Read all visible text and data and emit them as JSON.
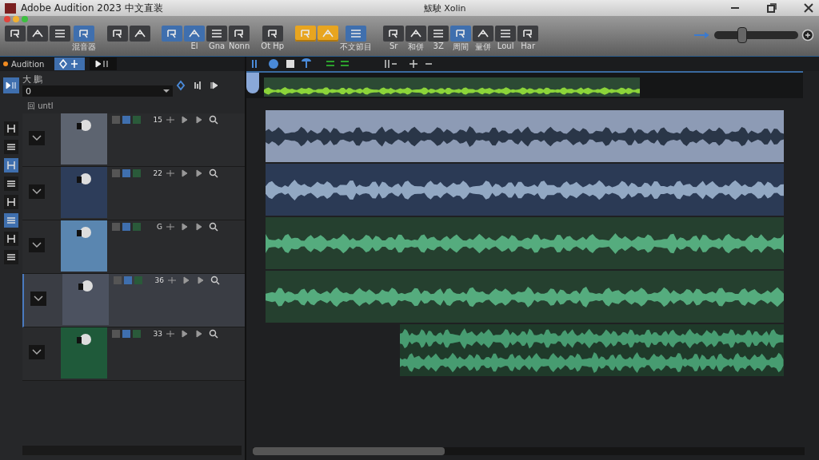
{
  "window": {
    "app_title": "Adobe Audition 2023 中文直装",
    "document_title": "鮁駛 Xolin"
  },
  "toolbar": {
    "groups": [
      {
        "buttons": [
          {
            "kind": "plain",
            "selected": false
          },
          {
            "kind": "plain",
            "selected": false
          },
          {
            "kind": "plain",
            "selected": false
          },
          {
            "kind": "plain",
            "label": "混音器",
            "selected": true
          }
        ]
      },
      {
        "buttons": [
          {
            "kind": "plain",
            "selected": false
          },
          {
            "kind": "plain",
            "selected": false
          }
        ]
      },
      {
        "buttons": [
          {
            "kind": "plain",
            "selected": true
          },
          {
            "kind": "plain",
            "label": "El",
            "selected": true
          },
          {
            "kind": "plain",
            "label": "Gna",
            "selected": false
          },
          {
            "kind": "plain",
            "label": "Nonn",
            "selected": false
          }
        ]
      },
      {
        "buttons": [
          {
            "kind": "plain",
            "label": "Ot Hp",
            "selected": false
          }
        ]
      },
      {
        "buttons": [
          {
            "kind": "accent",
            "selected": true
          },
          {
            "kind": "accent",
            "selected": true
          },
          {
            "kind": "plain",
            "label": "不文節目",
            "selected": true
          }
        ]
      },
      {
        "buttons": [
          {
            "kind": "plain",
            "label": "Sr",
            "selected": false
          },
          {
            "kind": "plain",
            "label": "和併",
            "selected": false
          },
          {
            "kind": "plain",
            "label": "3Z",
            "selected": false
          },
          {
            "kind": "plain",
            "label": "周間",
            "selected": true
          },
          {
            "kind": "plain",
            "label": "量併",
            "selected": false
          },
          {
            "kind": "plain",
            "label": "Loul",
            "selected": false
          },
          {
            "kind": "plain",
            "label": "Har",
            "selected": false
          }
        ]
      }
    ],
    "zoom_slider": {
      "level": 0.3
    }
  },
  "panel": {
    "tab": "Audition",
    "field_label": "大 鵬",
    "field_value": "0",
    "list_header": "回 untl"
  },
  "side_tools": [
    {
      "selected": false
    },
    {
      "selected": false
    },
    {
      "selected": true
    },
    {
      "selected": false
    },
    {
      "selected": false
    },
    {
      "selected": true
    },
    {
      "selected": false
    },
    {
      "selected": false
    }
  ],
  "tracks": [
    {
      "number": "15",
      "color": "#5d6470",
      "selected": false,
      "clip": {
        "kind": "mono",
        "offset": false,
        "color": "#8d9bb5"
      }
    },
    {
      "number": "22",
      "color": "#2d3d5a",
      "selected": false,
      "clip": {
        "kind": "mono",
        "offset": false,
        "color": "#2b3a55"
      }
    },
    {
      "number": "G",
      "color": "#5a86b0",
      "selected": false,
      "clip": {
        "kind": "mono",
        "offset": false,
        "color": "#25402f"
      }
    },
    {
      "number": "36",
      "color": "#4c5260",
      "selected": true,
      "clip": {
        "kind": "mono",
        "offset": false,
        "color": "#25402f"
      }
    },
    {
      "number": "33",
      "color": "#1f5a3a",
      "selected": false,
      "clip": {
        "kind": "stereo",
        "offset": true,
        "color": "#1f3a2a"
      }
    }
  ]
}
